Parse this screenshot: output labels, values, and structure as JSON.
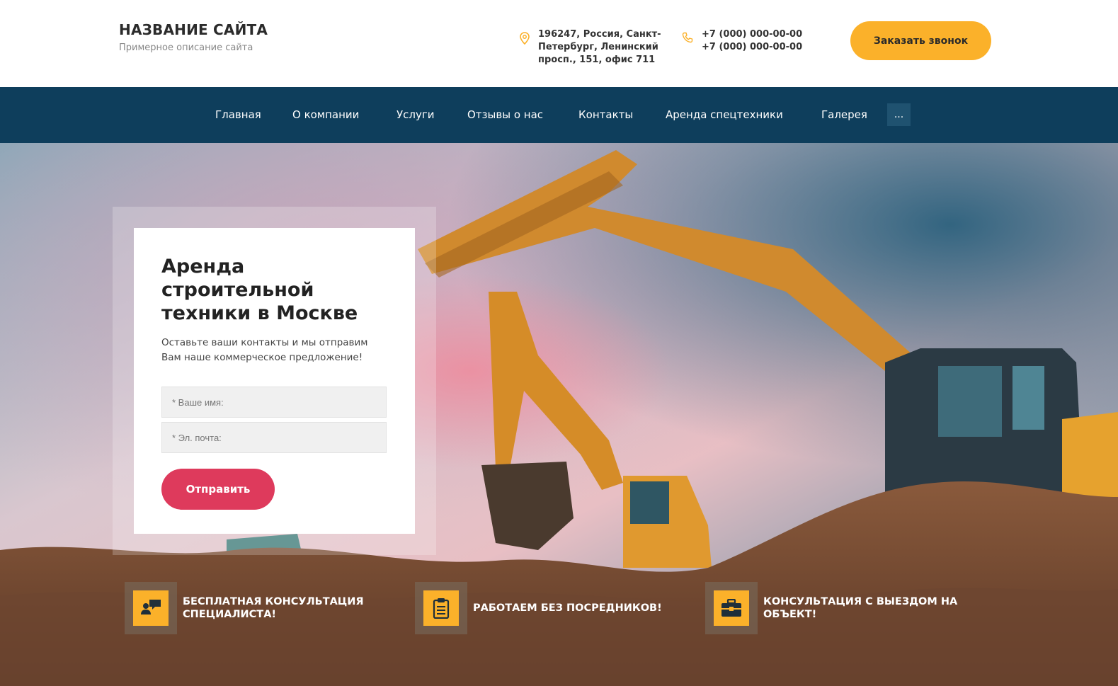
{
  "header": {
    "site_title": "НАЗВАНИЕ САЙТА",
    "site_description": "Примерное описание сайта",
    "address_lines": [
      "196247, Россия, Санкт-",
      "Петербург, Ленинский",
      "просп., 151, офис 711"
    ],
    "phones": [
      "+7 (000) 000-00-00",
      "+7 (000) 000-00-00"
    ],
    "call_button": "Заказать звонок",
    "address_icon": "map-pin-icon",
    "phone_icon": "phone-icon"
  },
  "nav": {
    "items": [
      "Главная",
      "О компании",
      "Услуги",
      "Отзывы о нас",
      "Контакты",
      "Аренда спецтехники",
      "Галерея"
    ],
    "more": "..."
  },
  "form": {
    "title": "Аренда строительной техники в Москве",
    "subtitle": "Оставьте ваши контакты и мы отправим Вам наше коммерческое предложение!",
    "name_placeholder": "* Ваше имя:",
    "email_placeholder": "* Эл. почта:",
    "submit": "Отправить"
  },
  "features": [
    {
      "text_lines": [
        "БЕСПЛАТНАЯ КОНСУЛЬТАЦИЯ",
        "СПЕЦИАЛИСТА!"
      ],
      "icon": "chat-consultation-icon"
    },
    {
      "text_lines": [
        "РАБОТАЕМ БЕЗ ПОСРЕДНИКОВ!"
      ],
      "icon": "clipboard-icon"
    },
    {
      "text_lines": [
        "КОНСУЛЬТАЦИЯ С ВЫЕЗДОМ НА",
        "ОБЪЕКТ!"
      ],
      "icon": "briefcase-icon"
    }
  ],
  "colors": {
    "accent_yellow": "#fbb12a",
    "nav_bg": "#0e3e5c",
    "submit_red": "#de3a5c"
  }
}
